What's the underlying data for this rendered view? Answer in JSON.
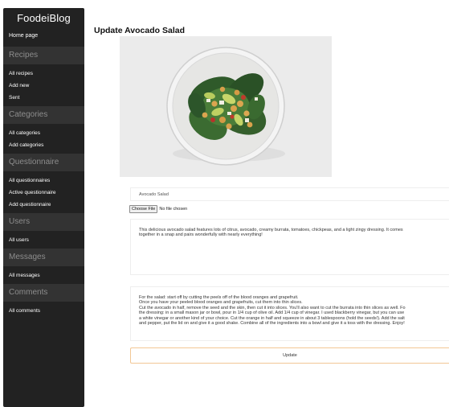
{
  "sidebar": {
    "brand": "FoodeiBlog",
    "home": "Home page",
    "sections": {
      "recipes": {
        "title": "Recipes",
        "items": [
          "All recipes",
          "Add new",
          "Sent"
        ]
      },
      "categories": {
        "title": "Categories",
        "items": [
          "All categories",
          "Add categories"
        ]
      },
      "questionnaire": {
        "title": "Questionnaire",
        "items": [
          "All questionnaires",
          "Active questionnaire",
          "Add questionnaire"
        ]
      },
      "users": {
        "title": "Users",
        "items": [
          "All users"
        ]
      },
      "messages": {
        "title": "Messages",
        "items": [
          "All messages"
        ]
      },
      "comments": {
        "title": "Comments",
        "items": [
          "All comments"
        ]
      }
    }
  },
  "main": {
    "title": "Update Avocado Salad",
    "name_value": "Avocado Salad",
    "file": {
      "button": "Choose File",
      "status": "No file chosen"
    },
    "description": "This delicious avocado salad features lots of citrus, avocado, creamy burrata, tomatoes, chickpeas, and a light zingy dressing. It comes\ntogether in a snap and pairs wonderfully with nearly everything!",
    "instructions": {
      "line1": "For the salad: start off by cutting the peels off of the blood oranges and grapefruit.",
      "line2": "Once you have your peeled blood oranges and grapefruits, cut them into thin slices.",
      "line3": "Cut the avocado in half, remove the seed and the skin, then cut it into slices. You'll also want to cut the burrata into thin slices as well. Fo",
      "line4": "the dressing: in a small mason jar or bowl, pour in 1/4 cup of olive oil. Add 1/4 cup of vinegar. I used blackberry vinegar, but you can use",
      "line5": "a white vinegar or another kind of your choice. Cut the orange in half and squeeze in about 3 tablespoons (hold the seeds!). Add the salt",
      "line6": "and pepper, put the lid on and give it a good shake. Combine all of the ingredients into a bowl and give it a toss with the dressing. Enjoy!"
    },
    "update_label": "Update"
  },
  "colors": {
    "sidebar_bg": "#222222",
    "section_bg": "#333333",
    "section_text": "#8d8d8d",
    "button_border": "#f2c795"
  },
  "icons": {}
}
